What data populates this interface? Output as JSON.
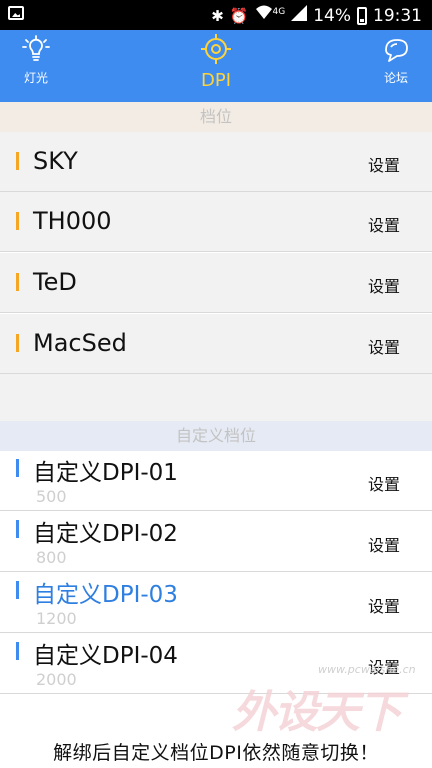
{
  "status_bar": {
    "battery_percent": "14%",
    "time": "19:31",
    "network": "4G",
    "icons": [
      "image-icon",
      "bluetooth-icon",
      "alarm-icon",
      "wifi-icon",
      "signal-icon",
      "battery-icon"
    ]
  },
  "header": {
    "left": {
      "label": "灯光",
      "icon": "lightbulb-icon"
    },
    "center": {
      "label": "DPI",
      "icon": "crosshair-icon"
    },
    "right": {
      "label": "论坛",
      "icon": "chat-bubble-icon"
    },
    "colors": {
      "background": "#3e8cf0",
      "active": "#ffd43a"
    }
  },
  "presets_section": {
    "title": "档位",
    "items": [
      {
        "name": "SKY",
        "action": "设置"
      },
      {
        "name": "TH000",
        "action": "设置"
      },
      {
        "name": "TeD",
        "action": "设置"
      },
      {
        "name": "MacSed",
        "action": "设置"
      }
    ]
  },
  "custom_section": {
    "title": "自定义档位",
    "items": [
      {
        "name": "自定义DPI-01",
        "value": "500",
        "action": "设置",
        "active": false
      },
      {
        "name": "自定义DPI-02",
        "value": "800",
        "action": "设置",
        "active": false
      },
      {
        "name": "自定义DPI-03",
        "value": "1200",
        "action": "设置",
        "active": true
      },
      {
        "name": "自定义DPI-04",
        "value": "2000",
        "action": "设置",
        "active": false
      }
    ]
  },
  "footer": {
    "text": "解绑后自定义档位DPI依然随意切换！"
  },
  "watermark": {
    "text": "外设天下",
    "url": "www.pcwaishe.cn"
  }
}
